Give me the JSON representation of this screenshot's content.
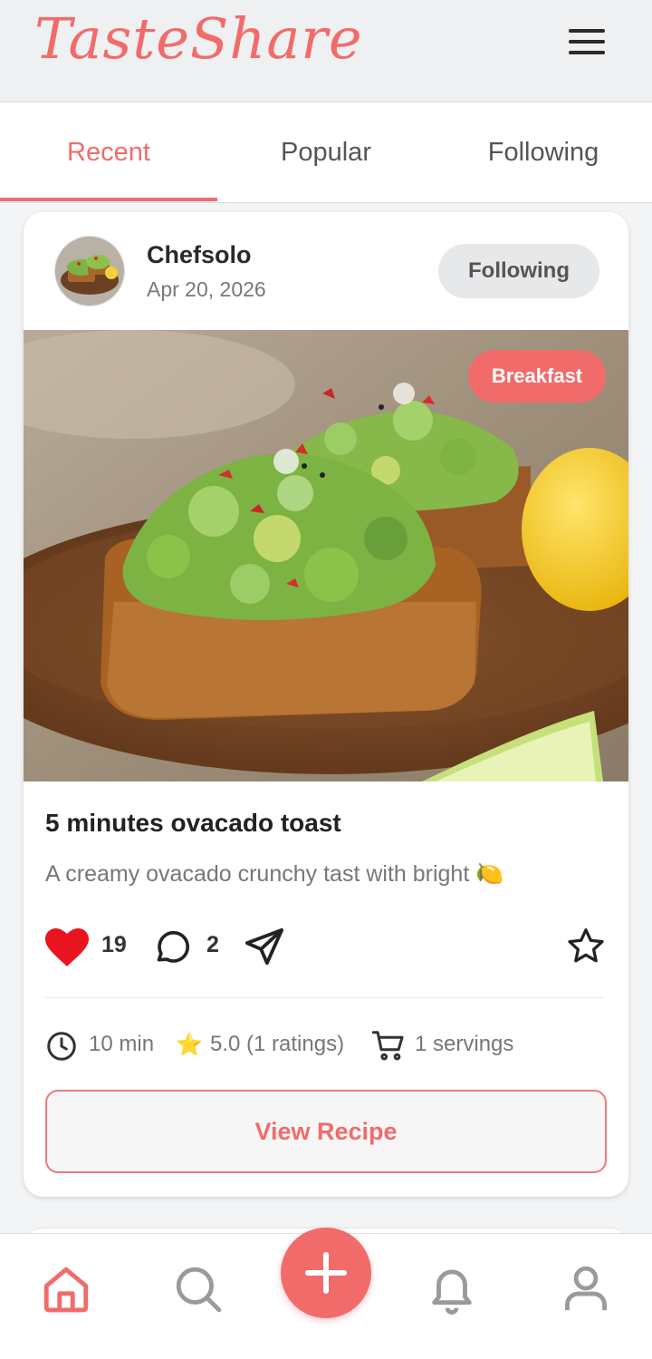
{
  "app": {
    "title": "TasteShare"
  },
  "colors": {
    "accent": "#f26b6b",
    "heart": "#e8141f",
    "star": "#f5c21a"
  },
  "tabs": [
    {
      "label": "Recent",
      "active": true
    },
    {
      "label": "Popular",
      "active": false
    },
    {
      "label": "Following",
      "active": false
    }
  ],
  "post": {
    "author": "Chefsolo",
    "date": "Apr 20, 2026",
    "follow_label": "Following",
    "category": "Breakfast",
    "title": "5 minutes ovacado toast",
    "description": "A creamy ovacado crunchy tast with bright 🍋",
    "likes": "19",
    "comments": "2",
    "liked": true,
    "bookmarked": false,
    "time": "10 min",
    "rating_icon": "⭐",
    "rating": "5.0 (1 ratings)",
    "servings": "1 servings",
    "view_label": "View Recipe"
  },
  "bottom_nav": [
    {
      "icon": "home-icon",
      "active": true
    },
    {
      "icon": "search-icon",
      "active": false
    },
    {
      "icon": "plus-icon",
      "active": false
    },
    {
      "icon": "bell-icon",
      "active": false
    },
    {
      "icon": "user-icon",
      "active": false
    }
  ]
}
